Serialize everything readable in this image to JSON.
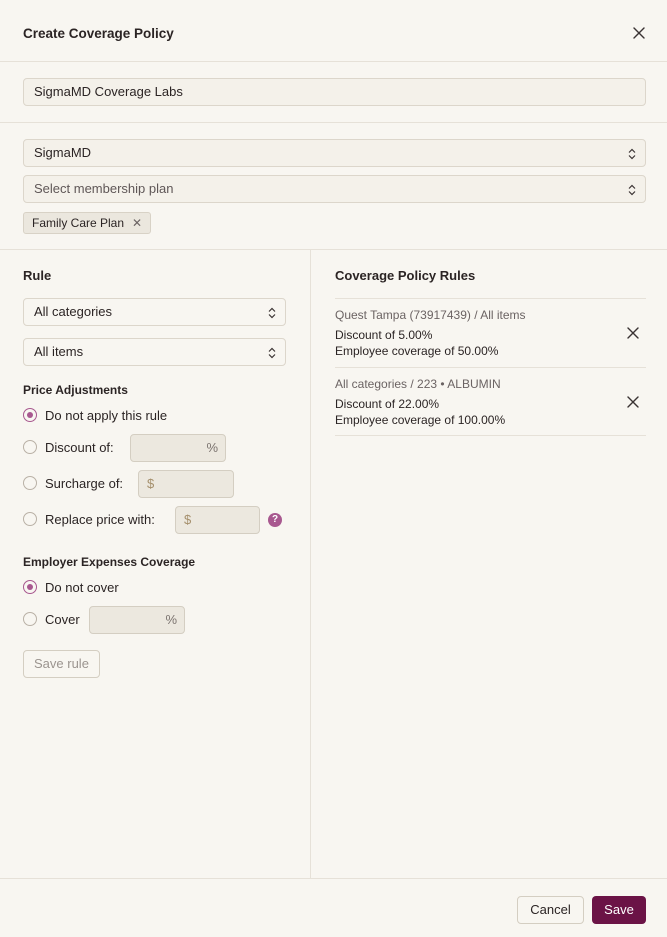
{
  "dialog": {
    "title": "Create Coverage Policy"
  },
  "policy_name": {
    "value": "SigmaMD Coverage Labs"
  },
  "organization_select": {
    "value": "SigmaMD"
  },
  "membership_select": {
    "placeholder": "Select membership plan"
  },
  "selected_plans": [
    {
      "label": "Family Care Plan",
      "remove_icon": "close-icon"
    }
  ],
  "rule": {
    "heading": "Rule",
    "category_select": "All categories",
    "items_select": "All items",
    "price_adjustments": {
      "heading": "Price Adjustments",
      "options": [
        {
          "label": "Do not apply this rule",
          "checked": true
        },
        {
          "label": "Discount of:",
          "suffix": "%"
        },
        {
          "label": "Surcharge of:",
          "prefix": "$"
        },
        {
          "label": "Replace price with:",
          "prefix": "$"
        }
      ]
    },
    "employer_coverage": {
      "heading": "Employer Expenses Coverage",
      "options": [
        {
          "label": "Do not cover",
          "checked": true
        },
        {
          "label": "Cover",
          "suffix": "%"
        }
      ]
    },
    "help_glyph": "?",
    "save_rule_label": "Save rule"
  },
  "coverage_rules": {
    "heading": "Coverage Policy Rules",
    "items": [
      {
        "title": "Quest Tampa (73917439) / All items",
        "discount": "Discount of 5.00%",
        "coverage": "Employee coverage of 50.00%"
      },
      {
        "title": "All categories / 223 • ALBUMIN",
        "discount": "Discount of 22.00%",
        "coverage": "Employee coverage of 100.00%"
      }
    ]
  },
  "footer": {
    "cancel_label": "Cancel",
    "save_label": "Save"
  },
  "colors": {
    "accent": "#a8588f",
    "primary_button": "#6b1346",
    "background": "#f8f6f1"
  }
}
